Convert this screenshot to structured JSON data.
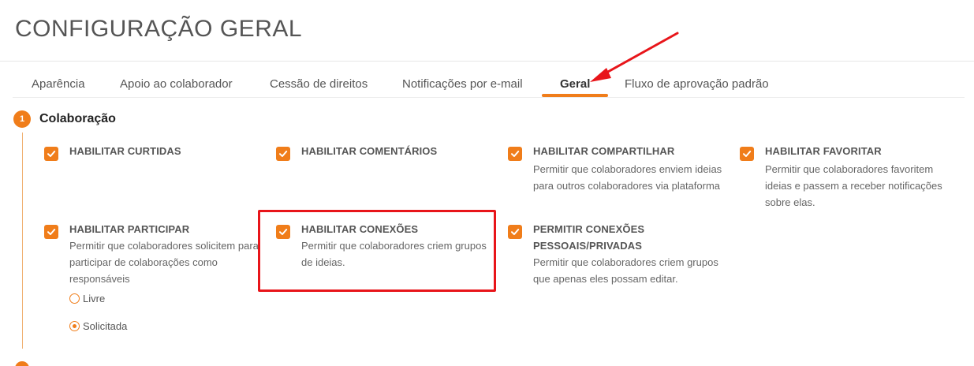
{
  "page_title": "CONFIGURAÇÃO GERAL",
  "tabs": [
    {
      "label": "Aparência"
    },
    {
      "label": "Apoio ao colaborador"
    },
    {
      "label": "Cessão de direitos"
    },
    {
      "label": "Notificações por e-mail"
    },
    {
      "label": "Geral",
      "active": true
    },
    {
      "label": "Fluxo de aprovação padrão"
    }
  ],
  "section": {
    "number": "1",
    "title": "Colaboração"
  },
  "options": [
    {
      "title": "HABILITAR CURTIDAS",
      "description": "",
      "checked": true
    },
    {
      "title": "HABILITAR COMENTÁRIOS",
      "description": "",
      "checked": true
    },
    {
      "title": "HABILITAR COMPARTILHAR",
      "description": "Permitir que colaboradores enviem ideias para outros colaboradores via plataforma",
      "checked": true
    },
    {
      "title": "HABILITAR FAVORITAR",
      "description": "Permitir que colaboradores favoritem ideias e passem a receber notificações sobre elas.",
      "checked": true
    },
    {
      "title": "HABILITAR PARTICIPAR",
      "description": "Permitir que colaboradores solicitem para participar de colaborações como responsáveis",
      "checked": true
    },
    {
      "title": "HABILITAR CONEXÕES",
      "description": "Permitir que colaboradores criem grupos de ideias.",
      "checked": true
    },
    {
      "title": "PERMITIR CONEXÕES PESSOAIS/PRIVADAS",
      "description": "Permitir que colaboradores criem grupos que apenas eles possam editar.",
      "checked": true
    }
  ],
  "participation_mode": {
    "options": [
      "Livre",
      "Solicitada"
    ],
    "selected": "Solicitada"
  },
  "colors": {
    "accent": "#f07d1a",
    "annotation_red": "#e8151a"
  },
  "icons": {
    "checkbox": "check-icon",
    "annotation": "red-arrow"
  }
}
